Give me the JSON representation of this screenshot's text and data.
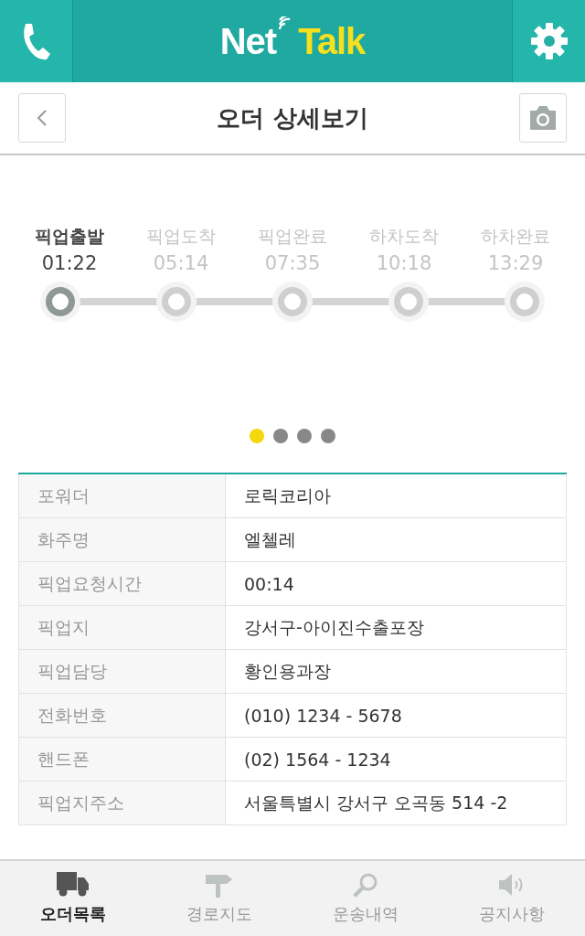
{
  "header": {
    "logo_part_1": "Net",
    "logo_part_2": "Talk"
  },
  "title": "오더 상세보기",
  "steps": [
    {
      "label": "픽업출발",
      "time": "01:22",
      "selected": true
    },
    {
      "label": "픽업도착",
      "time": "05:14",
      "selected": false
    },
    {
      "label": "픽업완료",
      "time": "07:35",
      "selected": false
    },
    {
      "label": "하차도착",
      "time": "10:18",
      "selected": false
    },
    {
      "label": "하차완료",
      "time": "13:29",
      "selected": false
    }
  ],
  "pager": [
    {
      "selected": true
    },
    {
      "selected": false
    },
    {
      "selected": false
    },
    {
      "selected": false
    }
  ],
  "details": [
    {
      "label": "포워더",
      "value": "로릭코리아"
    },
    {
      "label": "화주명",
      "value": "엘첼레"
    },
    {
      "label": "픽업요청시간",
      "value": "00:14"
    },
    {
      "label": "픽업지",
      "value": "강서구-아이진수출포장"
    },
    {
      "label": "픽업담당",
      "value": "황인용과장"
    },
    {
      "label": "전화번호",
      "value": "(010) 1234 - 5678"
    },
    {
      "label": "핸드폰",
      "value": "(02) 1564 - 1234"
    },
    {
      "label": "픽업지주소",
      "value": "서울특별시 강서구 오곡동 514 -2"
    }
  ],
  "tabs": [
    {
      "kind": "truck",
      "label": "오더목록",
      "selected": true
    },
    {
      "kind": "signpost",
      "label": "경로지도",
      "selected": false
    },
    {
      "kind": "search",
      "label": "운송내역",
      "selected": false
    },
    {
      "kind": "speaker",
      "label": "공지사항",
      "selected": false
    }
  ]
}
